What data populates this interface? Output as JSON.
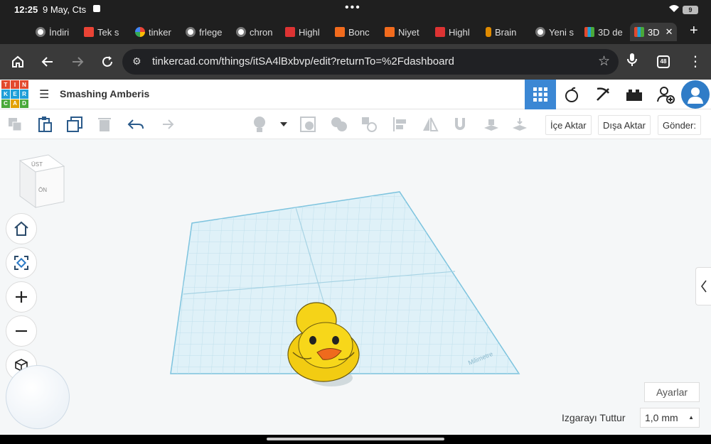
{
  "status": {
    "time": "12:25",
    "date": "9 May, Cts",
    "battery": "9"
  },
  "tabs": [
    {
      "label": "İndiri",
      "fav_color": "#ffffff",
      "icon": "chrome-icon"
    },
    {
      "label": "Tek s",
      "fav_color": "#ea4335",
      "icon": "gmail-icon"
    },
    {
      "label": "tinker",
      "fav_color": "#4285f4",
      "icon": "google-icon"
    },
    {
      "label": "frlege",
      "fav_color": "#ffffff",
      "icon": "chrome-icon"
    },
    {
      "label": "chron",
      "fav_color": "#ffffff",
      "icon": "chrome-icon"
    },
    {
      "label": "Highl",
      "fav_color": "#d33",
      "icon": "site-icon"
    },
    {
      "label": "Bonc",
      "fav_color": "#f26b1d",
      "icon": "hb-icon"
    },
    {
      "label": "Niyet",
      "fav_color": "#f26b1d",
      "icon": "hb-icon"
    },
    {
      "label": "Highl",
      "fav_color": "#d33",
      "icon": "site-icon"
    },
    {
      "label": "Brain",
      "fav_color": "#e08b00",
      "icon": "brain-icon"
    },
    {
      "label": "Yeni s",
      "fav_color": "#ffffff",
      "icon": "chrome-icon"
    },
    {
      "label": "3D de",
      "fav_color": "#e2a000",
      "icon": "tinkercad-icon"
    },
    {
      "label": "3D",
      "fav_color": "#e2a000",
      "icon": "tinkercad-icon"
    }
  ],
  "omnibox": {
    "url": "tinkercad.com/things/itSA4lBxbvp/edit?returnTo=%2Fdashboard",
    "tab_count": "48"
  },
  "app": {
    "logo_letters": [
      "T",
      "I",
      "N",
      "K",
      "E",
      "R",
      "C",
      "A",
      "D"
    ],
    "logo_colors": [
      "#e2492d",
      "#e2492d",
      "#e2492d",
      "#1f9fd8",
      "#1f9fd8",
      "#1f9fd8",
      "#4aa93b",
      "#e2a000",
      "#4aa93b"
    ],
    "project_name": "Smashing Amberis",
    "toolbar": {
      "import": "İçe Aktar",
      "export": "Dışa Aktar",
      "send": "Gönder:"
    },
    "viewcube": {
      "top": "ÜST",
      "front": "ÖN"
    },
    "workplane_unit": "Milimetre",
    "settings_button": "Ayarlar",
    "snap_grid_label": "Izgarayı Tuttur",
    "snap_grid_value": "1,0 mm"
  }
}
